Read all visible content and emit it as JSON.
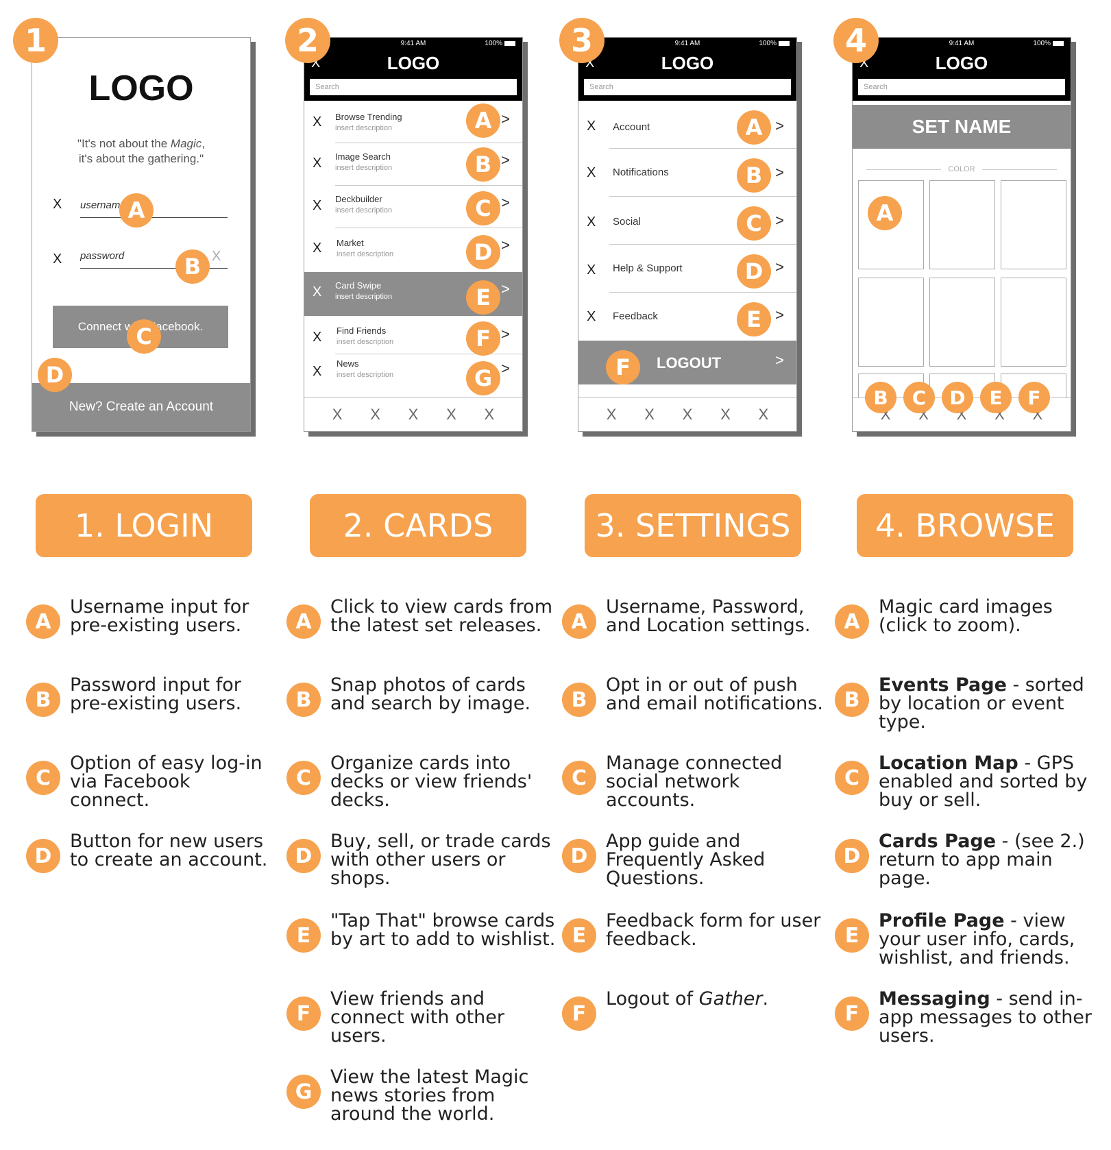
{
  "steps": [
    "1",
    "2",
    "3",
    "4"
  ],
  "markers": [
    "A",
    "B",
    "C",
    "D",
    "E",
    "F",
    "G"
  ],
  "phone": {
    "time": "9:41 AM",
    "battery": "100%",
    "logo": "LOGO",
    "search_placeholder": "Search",
    "close_glyph": "X",
    "chevron": ">"
  },
  "login": {
    "logo": "LOGO",
    "quote_line1": "\"It's not about the ",
    "quote_magic": "Magic",
    "quote_line1_end": ",",
    "quote_line2": "it's about the gathering.\"",
    "username_placeholder": "username",
    "password_placeholder": "password",
    "facebook_button": "Connect with Facebook.",
    "create_account": "New? Create an Account",
    "field_icon": "X"
  },
  "cards": {
    "items": [
      {
        "title": "Browse Trending",
        "desc": "insert description"
      },
      {
        "title": "Image Search",
        "desc": "insert description"
      },
      {
        "title": "Deckbuilder",
        "desc": "insert description"
      },
      {
        "title": "Market",
        "desc": "insert description"
      },
      {
        "title": "Card Swipe",
        "desc": "insert description"
      },
      {
        "title": "Find Friends",
        "desc": "insert description"
      },
      {
        "title": "News",
        "desc": "insert description"
      }
    ],
    "tabs": [
      "X",
      "X",
      "X",
      "X",
      "X"
    ]
  },
  "settings": {
    "items": [
      "Account",
      "Notifications",
      "Social",
      "Help & Support",
      "Feedback"
    ],
    "logout": "LOGOUT",
    "tabs": [
      "X",
      "X",
      "X",
      "X",
      "X"
    ]
  },
  "browse": {
    "set_name": "SET NAME",
    "color_label": "COLOR",
    "tabs": [
      "X",
      "X",
      "X",
      "X",
      "X"
    ]
  },
  "sections": [
    "1. LOGIN",
    "2. CARDS",
    "3. SETTINGS",
    "4. BROWSE"
  ],
  "legend": {
    "login": [
      {
        "marker": "A",
        "text": "Username input for pre-existing users."
      },
      {
        "marker": "B",
        "text": "Password input for pre-existing users."
      },
      {
        "marker": "C",
        "text": "Option of easy log-in via Facebook connect."
      },
      {
        "marker": "D",
        "text": "Button for new users to create an account."
      }
    ],
    "cards": [
      {
        "marker": "A",
        "text": "Click to view cards from the latest set releases."
      },
      {
        "marker": "B",
        "text": "Snap photos of cards and search by image."
      },
      {
        "marker": "C",
        "text": "Organize cards into decks or view friends' decks."
      },
      {
        "marker": "D",
        "text": "Buy, sell, or trade cards with other users or shops."
      },
      {
        "marker": "E",
        "text": "\"Tap That\" browse cards by art to add to wishlist."
      },
      {
        "marker": "F",
        "text": "View friends and connect with other users."
      },
      {
        "marker": "G",
        "text": "View the latest Magic news stories from around the world."
      }
    ],
    "settings": [
      {
        "marker": "A",
        "text": "Username, Password, and Location settings."
      },
      {
        "marker": "B",
        "text": "Opt in or out of push and email notifications."
      },
      {
        "marker": "C",
        "text": "Manage connected social network accounts."
      },
      {
        "marker": "D",
        "text": "App guide and Frequently Asked Questions."
      },
      {
        "marker": "E",
        "text": "Feedback form for user feedback."
      },
      {
        "marker": "F",
        "text_pre": "Logout of ",
        "text_em": "Gather",
        "text_post": "."
      }
    ],
    "browse": [
      {
        "marker": "A",
        "text": "Magic card images (click to zoom)."
      },
      {
        "marker": "B",
        "bold": "Events Page",
        "text": " - sorted by location or event type."
      },
      {
        "marker": "C",
        "bold": "Location Map",
        "text": " - GPS enabled and sorted by buy or sell."
      },
      {
        "marker": "D",
        "bold": "Cards Page",
        "text": " - (see 2.) return to app main page."
      },
      {
        "marker": "E",
        "bold": "Profile Page",
        "text": " - view your user info, cards, wishlist, and friends."
      },
      {
        "marker": "F",
        "bold": "Messaging",
        "text": " - send in-app messages to other users."
      }
    ]
  }
}
